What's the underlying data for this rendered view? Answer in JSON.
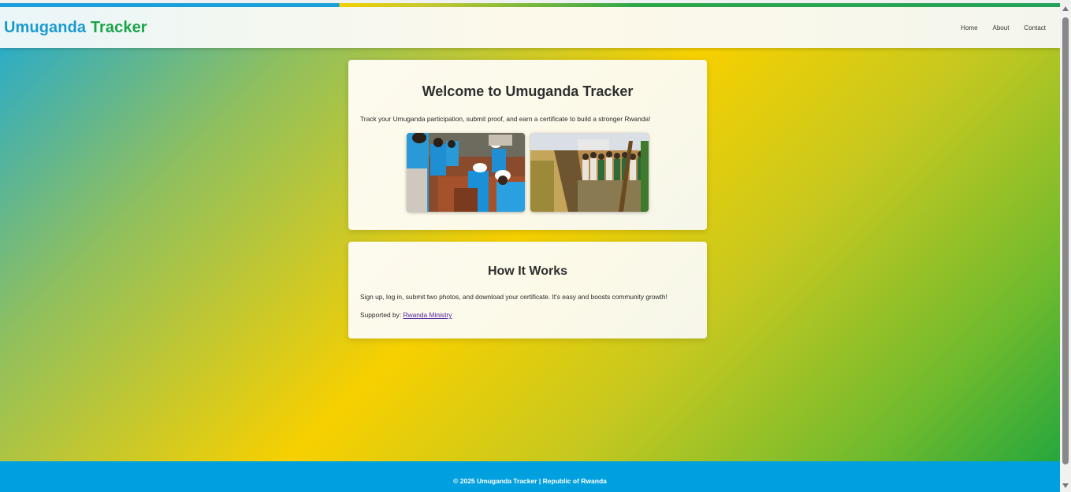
{
  "header": {
    "brand_part1": "Umuganda",
    "brand_part2": "Tracker",
    "nav": [
      "Home",
      "About",
      "Contact"
    ]
  },
  "welcome": {
    "title": "Welcome to Umuganda Tracker",
    "text": "Track your Umuganda participation, submit proof, and earn a certificate to build a stronger Rwanda!"
  },
  "how": {
    "title": "How It Works",
    "text": "Sign up, log in, submit two photos, and download your certificate. It's easy and boosts community growth!",
    "supported_label": "Supported by:",
    "supported_link": "Rwanda Ministry"
  },
  "footer": {
    "text": "© 2025 Umuganda Tracker | Republic of Rwanda"
  },
  "colors": {
    "brand_blue": "#1a9ad1",
    "brand_green": "#1ba34a",
    "footer_blue": "#00a0de",
    "link_purple": "#4a1aa0"
  }
}
